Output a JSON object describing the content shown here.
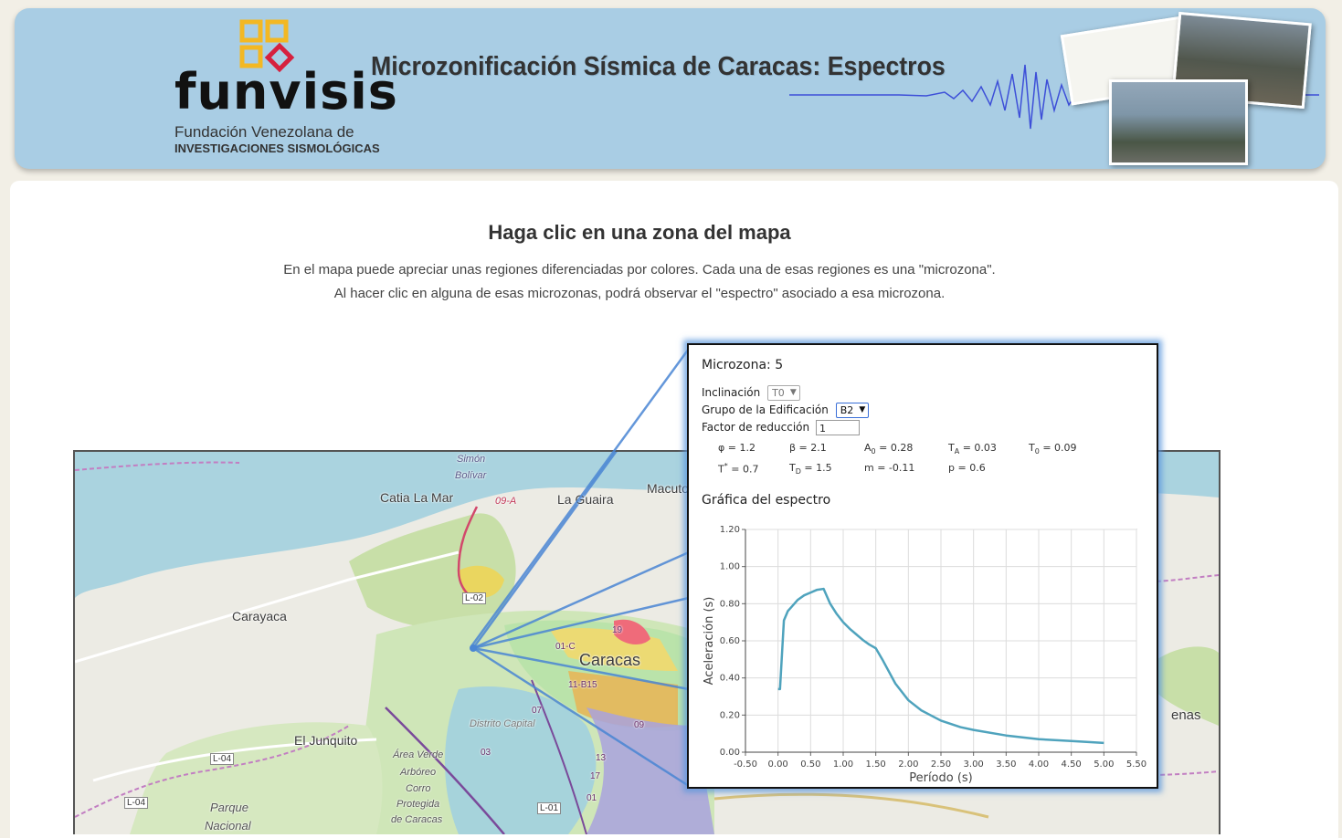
{
  "header": {
    "brand_word": "funvisis",
    "brand_sub1": "Fundación Venezolana de",
    "brand_sub2": "INVESTIGACIONES SISMOLÓGICAS",
    "site_title": "Microzonificación Sísmica de Caracas: Espectros",
    "logo_colors": {
      "square": "#f3b823",
      "diamond": "#d6203e"
    }
  },
  "content": {
    "heading": "Haga clic en una zona del mapa",
    "intro_line1": "En el mapa puede apreciar unas regiones diferenciadas por colores. Cada una de esas regiones es una \"microzona\".",
    "intro_line2": "Al hacer clic en alguna de esas microzonas, podrá observar el \"espectro\" asociado a esa microzona."
  },
  "map": {
    "labels": {
      "simon": "Simón",
      "bolivar": "Bolívar",
      "catia": "Catia La Mar",
      "road_09a": "09-A",
      "la_guaira": "La Guaira",
      "macuto": "Macuto",
      "carayaca": "Carayaca",
      "caracas": "Caracas",
      "el_junquito": "El Junquito",
      "distrito": "Distrito Capital",
      "area_verde": "Área Verde",
      "arboreo": "Arbóreo",
      "corro": "Corro",
      "protegida": "Protegida",
      "de_caracas": "de Caracas",
      "parque": "Parque",
      "nacional": "Nacional",
      "enas": "enas",
      "l02": "L-02",
      "l04a": "L-04",
      "l04b": "L-04",
      "l01": "L-01",
      "z19": "19",
      "z01c": "01-C",
      "z11b15": "11-B15",
      "z07": "07",
      "z03": "03",
      "z13": "13",
      "z17": "17",
      "z01": "01",
      "z09": "09"
    }
  },
  "popup": {
    "title": "Microzona: 5",
    "inclinacion_label": "Inclinación",
    "inclinacion_value": "T0",
    "grupo_label": "Grupo de la Edificación",
    "grupo_value": "B2",
    "factor_label": "Factor de reducción",
    "factor_value": "1",
    "params": {
      "phi": "φ  = 1.2",
      "beta": "β  = 2.1",
      "a0_sym": "A",
      "a0_sub": "0",
      "a0_val": " = 0.28",
      "ta_sym": "T",
      "ta_sub": "A",
      "ta_val": " = 0.03",
      "t0_sym": "T",
      "t0_sub": "0",
      "t0_val": " = 0.09",
      "tstar": "T",
      "tstar_sup": "*",
      "tstar_val": " = 0.7",
      "td_sym": "T",
      "td_sub": "D",
      "td_val": " = 1.5",
      "m": "m  = -0.11",
      "p": "p   = 0.6"
    },
    "chart_title": "Gráfica del espectro"
  },
  "chart_data": {
    "type": "line",
    "xlabel": "Período (s)",
    "ylabel": "Aceleración (s)",
    "xlim": [
      -0.5,
      5.5
    ],
    "ylim": [
      0,
      1.2
    ],
    "xticks": [
      "-0.50",
      "0.00",
      "0.50",
      "1.00",
      "1.50",
      "2.00",
      "2.50",
      "3.00",
      "3.50",
      "4.00",
      "4.50",
      "5.00",
      "5.50"
    ],
    "yticks": [
      "0.00",
      "0.20",
      "0.40",
      "0.60",
      "0.80",
      "1.00",
      "1.20"
    ],
    "grid": true,
    "line_color": "#4fa3bd",
    "series": [
      {
        "x": [
          0.0,
          0.03,
          0.09,
          0.15,
          0.2,
          0.3,
          0.4,
          0.5,
          0.6,
          0.7,
          0.8,
          0.9,
          1.0,
          1.1,
          1.2,
          1.3,
          1.4,
          1.5,
          1.6,
          1.8,
          2.0,
          2.2,
          2.5,
          2.8,
          3.0,
          3.5,
          4.0,
          4.5,
          5.0
        ],
        "y": [
          0.34,
          0.34,
          0.71,
          0.76,
          0.78,
          0.82,
          0.845,
          0.86,
          0.875,
          0.88,
          0.8,
          0.745,
          0.7,
          0.665,
          0.635,
          0.605,
          0.58,
          0.56,
          0.5,
          0.37,
          0.28,
          0.225,
          0.17,
          0.135,
          0.12,
          0.09,
          0.07,
          0.06,
          0.05
        ]
      }
    ]
  }
}
